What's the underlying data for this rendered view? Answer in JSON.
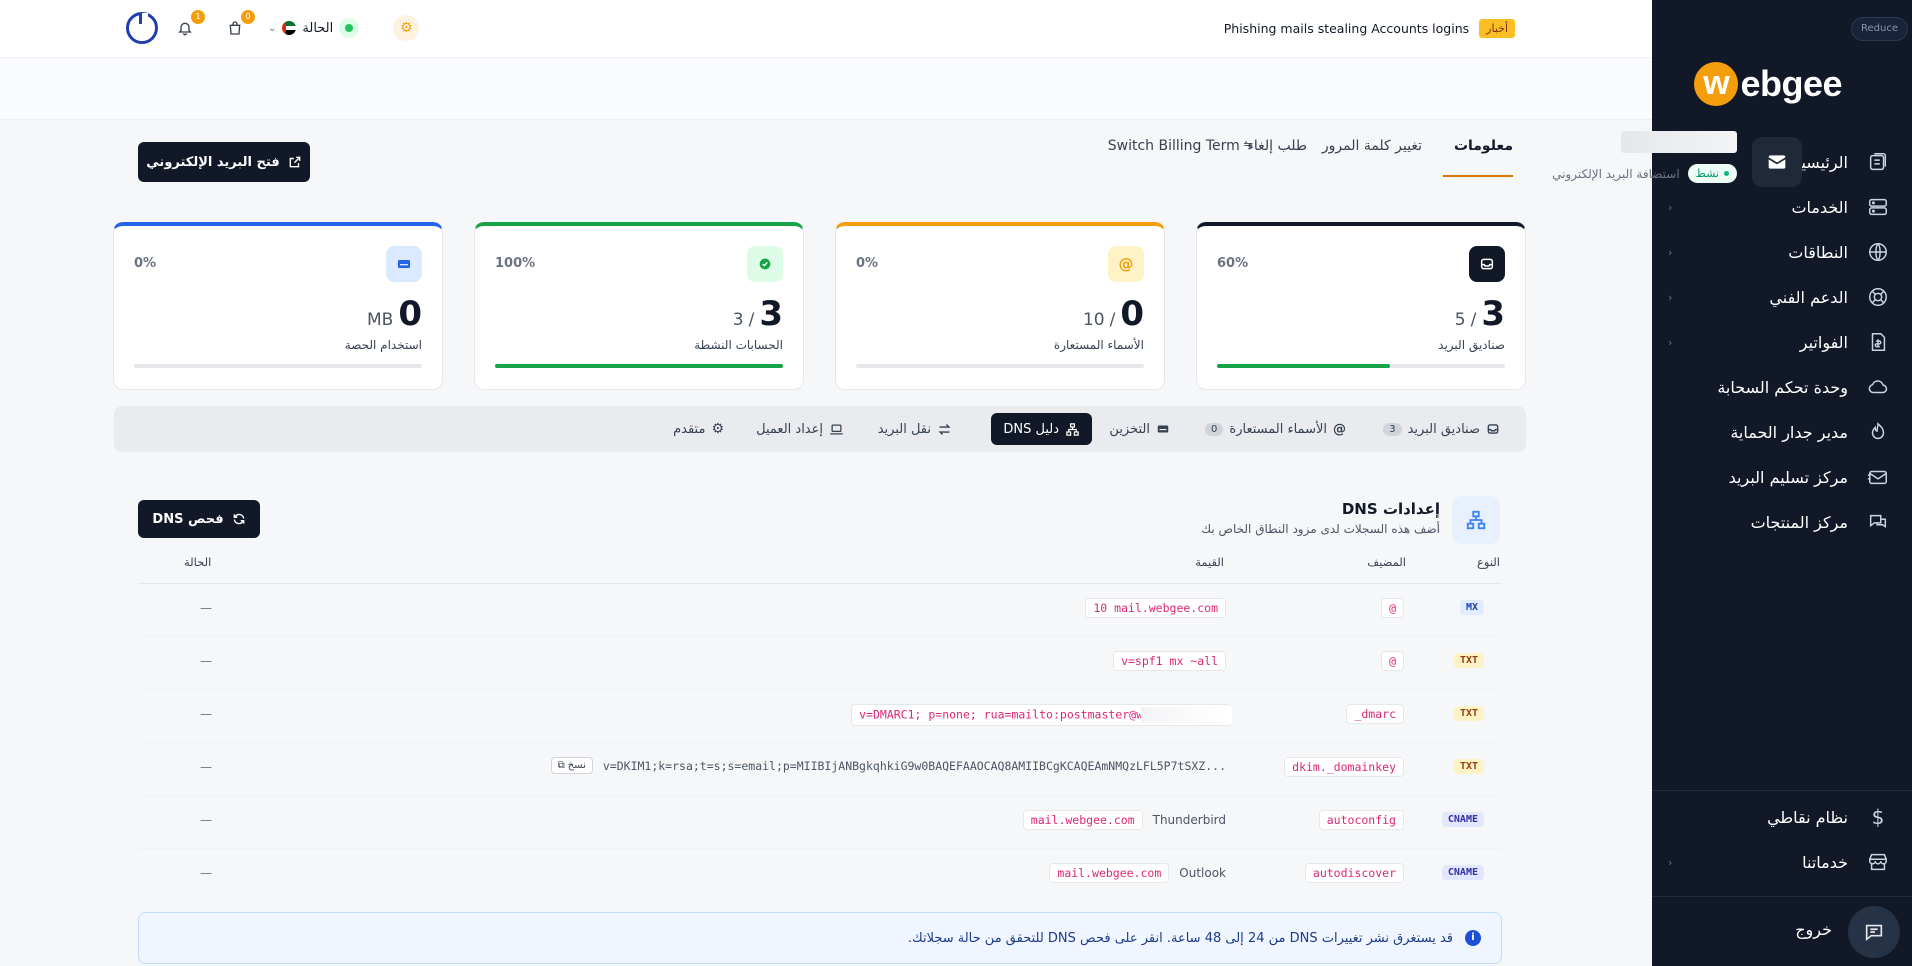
{
  "sidebar": {
    "reduce_label": "Reduce",
    "logo_letter": "w",
    "logo_text": "ebgee",
    "items": [
      {
        "label": "الرئيسية",
        "icon": "home-icon"
      },
      {
        "label": "الخدمات",
        "icon": "server-icon",
        "has_children": true
      },
      {
        "label": "النطاقات",
        "icon": "globe-icon",
        "has_children": true
      },
      {
        "label": "الدعم الفني",
        "icon": "lifebuoy-icon",
        "has_children": true
      },
      {
        "label": "الفواتير",
        "icon": "invoice-icon",
        "has_children": true
      },
      {
        "label": "وحدة تحكم السحابة",
        "icon": "cloud-icon"
      },
      {
        "label": "مدير جدار الحماية",
        "icon": "firewall-icon"
      },
      {
        "label": "مركز تسليم البريد",
        "icon": "mail-delivery-icon"
      },
      {
        "label": "مركز المنتجات",
        "icon": "chat-icon"
      }
    ],
    "bottom_items": [
      {
        "label": "نظام نقاطي",
        "icon": "dollar-icon"
      },
      {
        "label": "خدماتنا",
        "icon": "store-icon",
        "has_children": true
      }
    ],
    "logout_label": "خروج"
  },
  "topbar": {
    "news_badge": "أخبار",
    "news_text": "Phishing mails stealing Accounts logins",
    "status_label": "الحالة",
    "cart_count": "0",
    "notifications_count": "1"
  },
  "subtabs": [
    {
      "label": "معلومات",
      "active": true
    },
    {
      "label": "تغيير كلمة المرور"
    },
    {
      "label": "طلب إلغاء"
    },
    {
      "label": "Switch Billing Term"
    }
  ],
  "service": {
    "status": "نشط",
    "type": "استضافة البريد الإلكتروني",
    "open_mail_label": "فتح البريد الإلكتروني"
  },
  "stats": [
    {
      "value": "3",
      "of": "5",
      "label": "صناديق البريد",
      "percent": "60%",
      "fill": 0.6,
      "color": "#111827",
      "icon": "inbox-icon"
    },
    {
      "value": "0",
      "of": "10",
      "label": "الأسماء المستعارة",
      "percent": "0%",
      "fill": 0,
      "color": "#f59e0b",
      "icon": "at-icon"
    },
    {
      "value": "3",
      "of": "3",
      "label": "الحسابات النشطة",
      "percent": "100%",
      "fill": 1,
      "color": "#16a34a",
      "icon": "check-circle-icon"
    },
    {
      "value": "0",
      "unit": "MB",
      "label": "استخدام الحصة",
      "percent": "0%",
      "fill": 0,
      "color": "#2563eb",
      "icon": "storage-icon"
    }
  ],
  "tabs": [
    {
      "label": "صناديق البريد",
      "count": "3",
      "icon": "inbox-icon"
    },
    {
      "label": "الأسماء المستعارة",
      "count": "0",
      "icon": "at-icon"
    },
    {
      "label": "التخزين",
      "icon": "storage-icon"
    },
    {
      "label": "دليل DNS",
      "icon": "network-icon",
      "active": true
    },
    {
      "label": "نقل البريد",
      "icon": "transfer-icon"
    },
    {
      "label": "إعداد العميل",
      "icon": "laptop-icon"
    },
    {
      "label": "متقدم",
      "icon": "gear-icon"
    }
  ],
  "dns": {
    "title": "إعدادات DNS",
    "subtitle": "أضف هذه السجلات لدى مزود النطاق الخاص بك",
    "check_label": "فحص DNS",
    "headers": {
      "type": "النوع",
      "host": "المضيف",
      "value": "القيمة",
      "status": "الحالة"
    },
    "records": [
      {
        "type": "MX",
        "host": "@",
        "value": "10 mail.webgee.com",
        "status": "—"
      },
      {
        "type": "TXT",
        "host": "@",
        "value": "v=spf1 mx ~all",
        "status": "—"
      },
      {
        "type": "TXT",
        "host": "_dmarc",
        "value": "v=DMARC1; p=none; rua=mailto:postmaster@w",
        "status": "—"
      },
      {
        "type": "TXT",
        "host": "dkim._domainkey",
        "value": "v=DKIM1;k=rsa;t=s;s=email;p=MIIBIjANBgkqhkiG9w0BAQEFAAOCAQ8AMIIBCgKCAQEAmNMQzLFL5P7tSXZ...",
        "copy_label": "نسخ",
        "status": "—"
      },
      {
        "type": "CNAME",
        "host": "autoconfig",
        "value": "mail.webgee.com",
        "client": "Thunderbird",
        "status": "—"
      },
      {
        "type": "CNAME",
        "host": "autodiscover",
        "value": "mail.webgee.com",
        "client": "Outlook",
        "status": "—"
      }
    ],
    "info": "قد يستغرق نشر تغييرات DNS من 24 إلى 48 ساعة. انقر على فحص DNS للتحقق من حالة سجلاتك."
  }
}
